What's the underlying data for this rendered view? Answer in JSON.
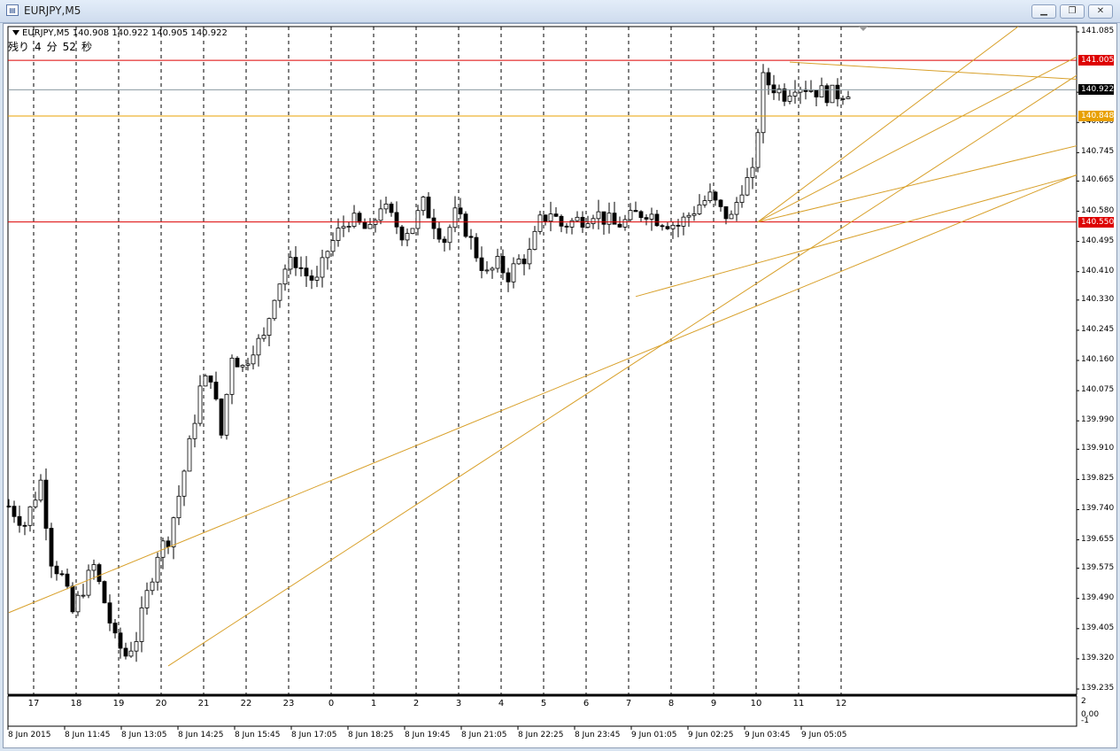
{
  "window": {
    "title": "EURJPY,M5",
    "app_icon": "chart-window-icon",
    "buttons": [
      "minimize-icon",
      "restore-icon",
      "close-icon"
    ]
  },
  "header": {
    "symbol": "EURJPY,M5",
    "open": "140.908",
    "high": "140.922",
    "low": "140.905",
    "close": "140.922",
    "timer": [
      "残り",
      "4",
      "分",
      "52",
      "秒"
    ]
  },
  "price_axis": {
    "labels": [
      "141.085",
      "140.915",
      "140.830",
      "140.745",
      "140.665",
      "140.580",
      "140.495",
      "140.410",
      "140.330",
      "140.245",
      "140.160",
      "140.075",
      "139.990",
      "139.910",
      "139.825",
      "139.740",
      "139.655",
      "139.575",
      "139.490",
      "139.405",
      "139.320",
      "139.235"
    ]
  },
  "hlines": [
    {
      "label": "141.005",
      "value": 141.005,
      "color": "#dd0000"
    },
    {
      "label": "140.922",
      "value": 140.922,
      "color": "#000000",
      "text_color": "#ffffff"
    },
    {
      "label": "140.848",
      "value": 140.848,
      "color": "#e8a000"
    },
    {
      "label": "140.550",
      "value": 140.55,
      "color": "#dd0000"
    }
  ],
  "time_axis": {
    "hours": [
      "17",
      "18",
      "19",
      "20",
      "21",
      "22",
      "23",
      "0",
      "1",
      "2",
      "3",
      "4",
      "5",
      "6",
      "7",
      "8",
      "9",
      "10",
      "11",
      "12"
    ],
    "dates": [
      "8 Jun 2015",
      "8 Jun 11:45",
      "8 Jun 13:05",
      "8 Jun 14:25",
      "8 Jun 15:45",
      "8 Jun 17:05",
      "8 Jun 18:25",
      "8 Jun 19:45",
      "8 Jun 21:05",
      "8 Jun 22:25",
      "8 Jun 23:45",
      "9 Jun 01:05",
      "9 Jun 02:25",
      "9 Jun 03:45",
      "9 Jun 05:05"
    ]
  },
  "sub_axis": {
    "top": "2",
    "mid": "0.00",
    "bottom": "-1"
  },
  "colors": {
    "up": "#ffffff",
    "down": "#000000",
    "support": "#dd0000",
    "trendline": "#d8a02a",
    "grid": "#000000"
  },
  "chart_data": {
    "type": "candlestick",
    "title": "EURJPY,M5",
    "ylim": [
      139.235,
      141.085
    ],
    "x": [
      "8 Jun 10:30",
      "9 Jun 05:50"
    ],
    "hour_starts": [
      17,
      18,
      19,
      20,
      21,
      22,
      23,
      0,
      1,
      2,
      3,
      4,
      5,
      6,
      7,
      8,
      9,
      10,
      11,
      12
    ],
    "close_path": [
      [
        0,
        139.75
      ],
      [
        3,
        139.7
      ],
      [
        6,
        139.82
      ],
      [
        8,
        139.6
      ],
      [
        10,
        139.55
      ],
      [
        12,
        139.45
      ],
      [
        14,
        139.52
      ],
      [
        16,
        139.58
      ],
      [
        18,
        139.48
      ],
      [
        20,
        139.37
      ],
      [
        22,
        139.33
      ],
      [
        24,
        139.38
      ],
      [
        26,
        139.5
      ],
      [
        28,
        139.62
      ],
      [
        30,
        139.66
      ],
      [
        32,
        139.78
      ],
      [
        34,
        139.92
      ],
      [
        36,
        140.08
      ],
      [
        38,
        140.12
      ],
      [
        40,
        139.95
      ],
      [
        42,
        140.18
      ],
      [
        44,
        140.14
      ],
      [
        46,
        140.2
      ],
      [
        48,
        140.22
      ],
      [
        50,
        140.35
      ],
      [
        52,
        140.42
      ],
      [
        54,
        140.44
      ],
      [
        56,
        140.4
      ],
      [
        58,
        140.38
      ],
      [
        60,
        140.47
      ],
      [
        62,
        140.52
      ],
      [
        64,
        140.56
      ],
      [
        66,
        140.54
      ],
      [
        68,
        140.52
      ],
      [
        70,
        140.6
      ],
      [
        72,
        140.56
      ],
      [
        74,
        140.52
      ],
      [
        76,
        140.54
      ],
      [
        78,
        140.6
      ],
      [
        80,
        140.55
      ],
      [
        82,
        140.5
      ],
      [
        84,
        140.57
      ],
      [
        86,
        140.53
      ],
      [
        88,
        140.46
      ],
      [
        90,
        140.4
      ],
      [
        92,
        140.43
      ],
      [
        94,
        140.4
      ],
      [
        96,
        140.44
      ],
      [
        98,
        140.46
      ],
      [
        100,
        140.55
      ],
      [
        102,
        140.58
      ],
      [
        104,
        140.54
      ],
      [
        106,
        140.55
      ],
      [
        108,
        140.56
      ],
      [
        110,
        140.58
      ],
      [
        112,
        140.56
      ],
      [
        114,
        140.54
      ],
      [
        116,
        140.55
      ],
      [
        118,
        140.57
      ],
      [
        120,
        140.58
      ],
      [
        122,
        140.56
      ],
      [
        124,
        140.55
      ],
      [
        126,
        140.54
      ],
      [
        128,
        140.57
      ],
      [
        130,
        140.6
      ],
      [
        132,
        140.62
      ],
      [
        134,
        140.58
      ],
      [
        136,
        140.56
      ],
      [
        138,
        140.65
      ],
      [
        140,
        140.68
      ],
      [
        142,
        140.95
      ],
      [
        144,
        140.93
      ],
      [
        146,
        140.91
      ],
      [
        148,
        140.94
      ],
      [
        150,
        140.93
      ],
      [
        152,
        140.92
      ],
      [
        154,
        140.91
      ],
      [
        156,
        140.91
      ],
      [
        158,
        140.922
      ]
    ],
    "trendlines_endpoints_price": [
      {
        "from": [
          0,
          139.45
        ],
        "to": [
          225,
          140.83
        ]
      },
      {
        "from": [
          30,
          139.3
        ],
        "to": [
          210,
          141.05
        ]
      },
      {
        "from": [
          118,
          140.34
        ],
        "to": [
          225,
          140.78
        ]
      },
      {
        "from": [
          141,
          140.55
        ],
        "to": [
          225,
          140.85
        ]
      },
      {
        "from": [
          141,
          140.55
        ],
        "to": [
          212,
          141.1
        ]
      },
      {
        "from": [
          141,
          140.55
        ],
        "to": [
          190,
          141.1
        ]
      },
      {
        "from": [
          147,
          141.0
        ],
        "to": [
          225,
          140.93
        ]
      }
    ]
  }
}
